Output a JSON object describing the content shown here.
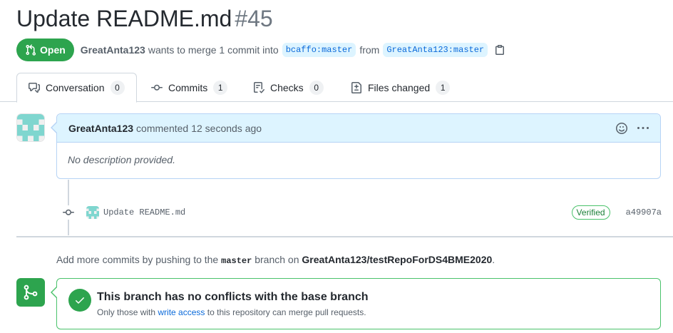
{
  "pr": {
    "title": "Update README.md",
    "number": "#45",
    "state": "Open",
    "author": "GreatAnta123",
    "merge_text": "wants to merge 1 commit into",
    "base_branch": "bcaffo:master",
    "from_text": "from",
    "head_branch": "GreatAnta123:master"
  },
  "tabs": [
    {
      "label": "Conversation",
      "count": "0",
      "icon": "comment-discussion-icon"
    },
    {
      "label": "Commits",
      "count": "1",
      "icon": "git-commit-icon"
    },
    {
      "label": "Checks",
      "count": "0",
      "icon": "checklist-icon"
    },
    {
      "label": "Files changed",
      "count": "1",
      "icon": "file-diff-icon"
    }
  ],
  "comment": {
    "author": "GreatAnta123",
    "action": "commented",
    "time": "12 seconds ago",
    "body": "No description provided."
  },
  "commit": {
    "message": "Update README.md",
    "badge": "Verified",
    "sha": "a49907a"
  },
  "hint": {
    "prefix": "Add more commits by pushing to the",
    "branch": "master",
    "middle": "branch on",
    "repo": "GreatAnta123/testRepoForDS4BME2020",
    "suffix": "."
  },
  "merge": {
    "title": "This branch has no conflicts with the base branch",
    "sub_prefix": "Only those with",
    "sub_link": "write access",
    "sub_suffix": "to this repository can merge pull requests."
  },
  "colors": {
    "open_green": "#2da44e",
    "link_blue": "#0969da",
    "comment_header_bg": "#ddf4ff",
    "identicon": "#7fd6cf"
  }
}
